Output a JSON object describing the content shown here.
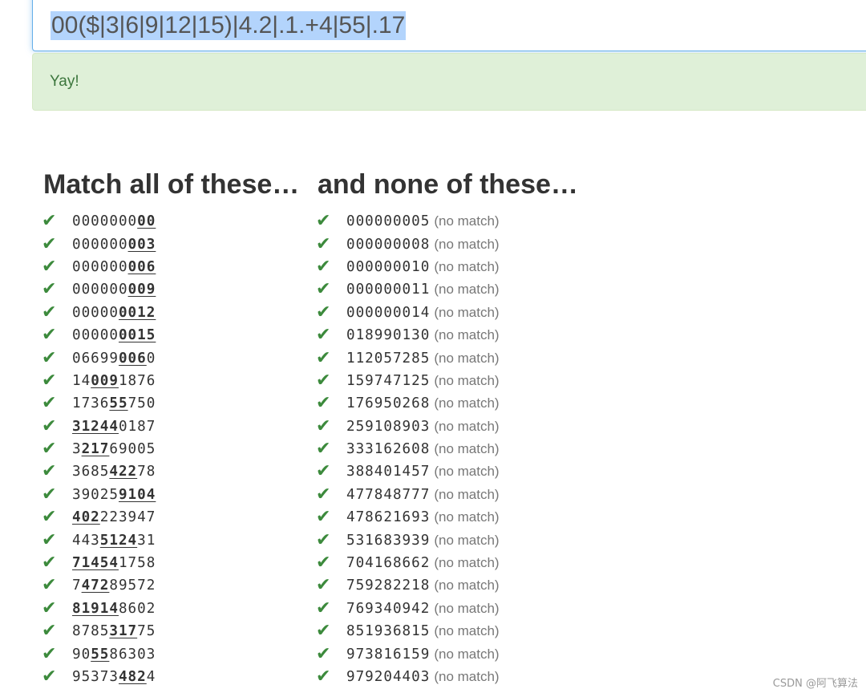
{
  "regex": {
    "value": "00($|3|6|9|12|15)|4.2|.1.+4|55|.17"
  },
  "alert": {
    "text": "Yay!"
  },
  "match_section": {
    "title": "Match all of these…",
    "items": [
      {
        "pre": "0000000",
        "match": "00",
        "post": ""
      },
      {
        "pre": "000000",
        "match": "003",
        "post": ""
      },
      {
        "pre": "000000",
        "match": "006",
        "post": ""
      },
      {
        "pre": "000000",
        "match": "009",
        "post": ""
      },
      {
        "pre": "00000",
        "match": "0012",
        "post": ""
      },
      {
        "pre": "00000",
        "match": "0015",
        "post": ""
      },
      {
        "pre": "06699",
        "match": "006",
        "post": "0"
      },
      {
        "pre": "14",
        "match": "009",
        "post": "1876"
      },
      {
        "pre": "1736",
        "match": "55",
        "post": "750"
      },
      {
        "pre": "",
        "match": "31244",
        "post": "0187"
      },
      {
        "pre": "3",
        "match": "217",
        "post": "69005"
      },
      {
        "pre": "3685",
        "match": "422",
        "post": "78"
      },
      {
        "pre": "39025",
        "match": "9104",
        "post": ""
      },
      {
        "pre": "",
        "match": "402",
        "post": "223947"
      },
      {
        "pre": "443",
        "match": "5124",
        "post": "31"
      },
      {
        "pre": "",
        "match": "71454",
        "post": "1758"
      },
      {
        "pre": "7",
        "match": "472",
        "post": "89572"
      },
      {
        "pre": "",
        "match": "81914",
        "post": "8602"
      },
      {
        "pre": "8785",
        "match": "317",
        "post": "75"
      },
      {
        "pre": "90",
        "match": "55",
        "post": "86303"
      },
      {
        "pre": "95373",
        "match": "482",
        "post": "4"
      }
    ]
  },
  "none_section": {
    "title": "and none of these…",
    "no_match_label": "(no match)",
    "items": [
      "000000005",
      "000000008",
      "000000010",
      "000000011",
      "000000014",
      "018990130",
      "112057285",
      "159747125",
      "176950268",
      "259108903",
      "333162608",
      "388401457",
      "477848777",
      "478621693",
      "531683939",
      "704168662",
      "759282218",
      "769340942",
      "851936815",
      "973816159",
      "979204403"
    ]
  },
  "check_icon": "check-mark-icon",
  "check_symbol": "✔",
  "colors": {
    "check": "#3c8a3c",
    "alert_bg": "#dff0d8",
    "alert_text": "#3c763d",
    "selection": "#b3d4fc"
  },
  "watermark": "CSDN @阿飞算法"
}
